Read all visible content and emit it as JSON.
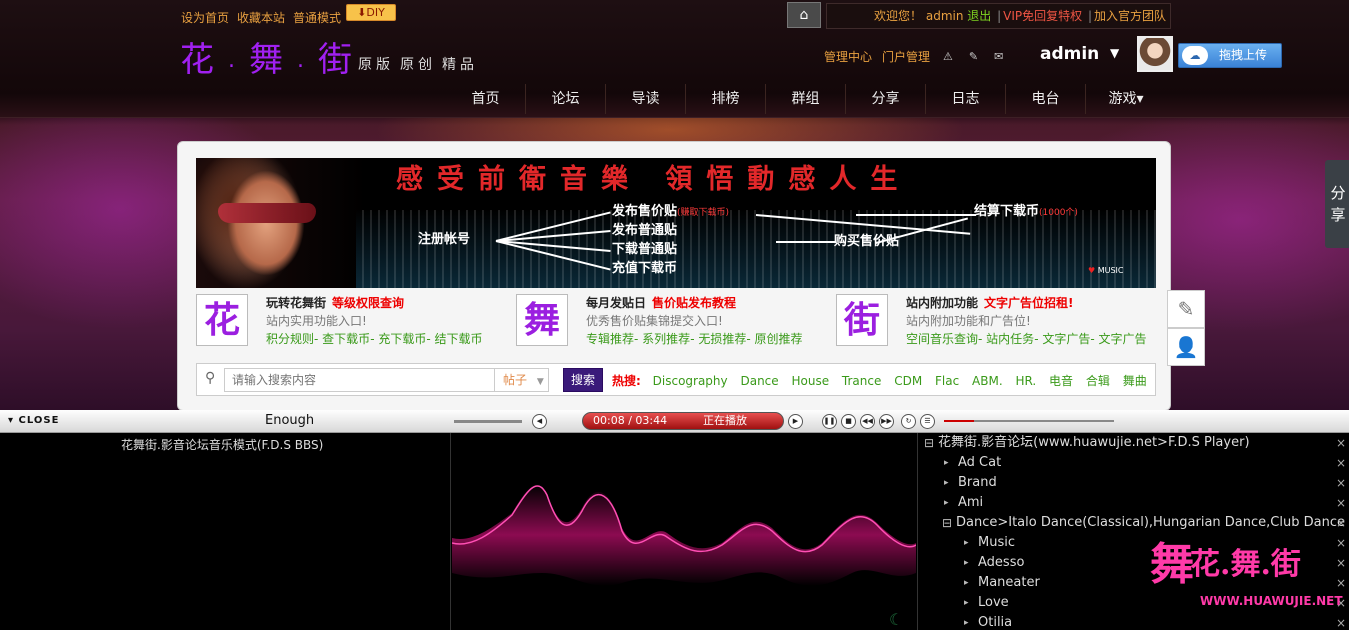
{
  "header": {
    "links": [
      "设为首页",
      "收藏本站",
      "普通模式"
    ],
    "diy": "DIY",
    "welcome": "欢迎您！",
    "user": "admin",
    "logout": "退出",
    "vip": "VIP免回复特权",
    "team": "加入官方团队",
    "logo_chars": [
      "花",
      "舞",
      "街"
    ],
    "logo_sub": [
      "原版",
      "原创",
      "精品"
    ],
    "mgmt": [
      "管理中心",
      "门户管理"
    ],
    "username": "admin",
    "upload": "拖拽上传"
  },
  "nav": [
    "首页",
    "论坛",
    "导读",
    "排榜",
    "群组",
    "分享",
    "日志",
    "电台",
    "游戏"
  ],
  "share_tab": "分享",
  "banner": {
    "title": "感受前衛音樂 領悟動感人生",
    "register": "注册帐号",
    "post_sale": "发布售价贴",
    "post_sale_note": "(赚取下载币)",
    "post_normal": "发布普通贴",
    "download_normal": "下载普通贴",
    "recharge": "充值下载币",
    "buy_sale": "购买售价贴",
    "settle": "结算下载币",
    "settle_note": "(1000个)",
    "logo_text": "MUSIC"
  },
  "features": [
    {
      "glyph": "花",
      "title": "玩转花舞街",
      "tag": "等级权限查询",
      "desc": "站内实用功能入口!",
      "links": [
        "积分规则",
        "查下载币",
        "充下载币",
        "结下载币"
      ]
    },
    {
      "glyph": "舞",
      "title": "每月发贴日",
      "tag": "售价贴发布教程",
      "desc": "优秀售价贴集锦提交入口!",
      "links": [
        "专辑推荐",
        "系列推荐",
        "无损推荐",
        "原创推荐"
      ]
    },
    {
      "glyph": "街",
      "title": "站内附加功能",
      "tag": "文字广告位招租!",
      "desc": "站内附加功能和广告位!",
      "links": [
        "空间音乐查询",
        "站内任务",
        "文字广告",
        "文字广告"
      ]
    }
  ],
  "search": {
    "placeholder": "请输入搜索内容",
    "type": "帖子",
    "button": "搜索",
    "hot_label": "热搜:",
    "hot": [
      "Discography",
      "Dance",
      "House",
      "Trance",
      "CDM",
      "Flac",
      "ABM.",
      "HR.",
      "电音",
      "合辑",
      "舞曲"
    ]
  },
  "player": {
    "close": "CLOSE",
    "track": "Enough",
    "time": "00:08 / 03:44",
    "status": "正在播放",
    "caption": "花舞街.影音论坛音乐模式(F.D.S BBS)",
    "playlist": [
      {
        "label": "花舞街.影音论坛(www.huawujie.net>F.D.S Player)",
        "level": 0,
        "type": "minus"
      },
      {
        "label": "Ad Cat",
        "level": 1,
        "type": "arrow"
      },
      {
        "label": "Brand",
        "level": 1,
        "type": "arrow"
      },
      {
        "label": "Ami",
        "level": 1,
        "type": "arrow"
      },
      {
        "label": "Dance>Italo Dance(Classical),Hungarian Dance,Club Dance",
        "level": 1,
        "type": "minus"
      },
      {
        "label": "Music",
        "level": 2,
        "type": "arrow"
      },
      {
        "label": "Adesso",
        "level": 2,
        "type": "arrow"
      },
      {
        "label": "Maneater",
        "level": 2,
        "type": "arrow"
      },
      {
        "label": "Love",
        "level": 2,
        "type": "arrow"
      },
      {
        "label": "Otilia",
        "level": 2,
        "type": "arrow"
      }
    ]
  },
  "watermark": {
    "mark": "舞",
    "text": "花.舞.街",
    "url": "WWW.HUAWUJIE.NET"
  }
}
